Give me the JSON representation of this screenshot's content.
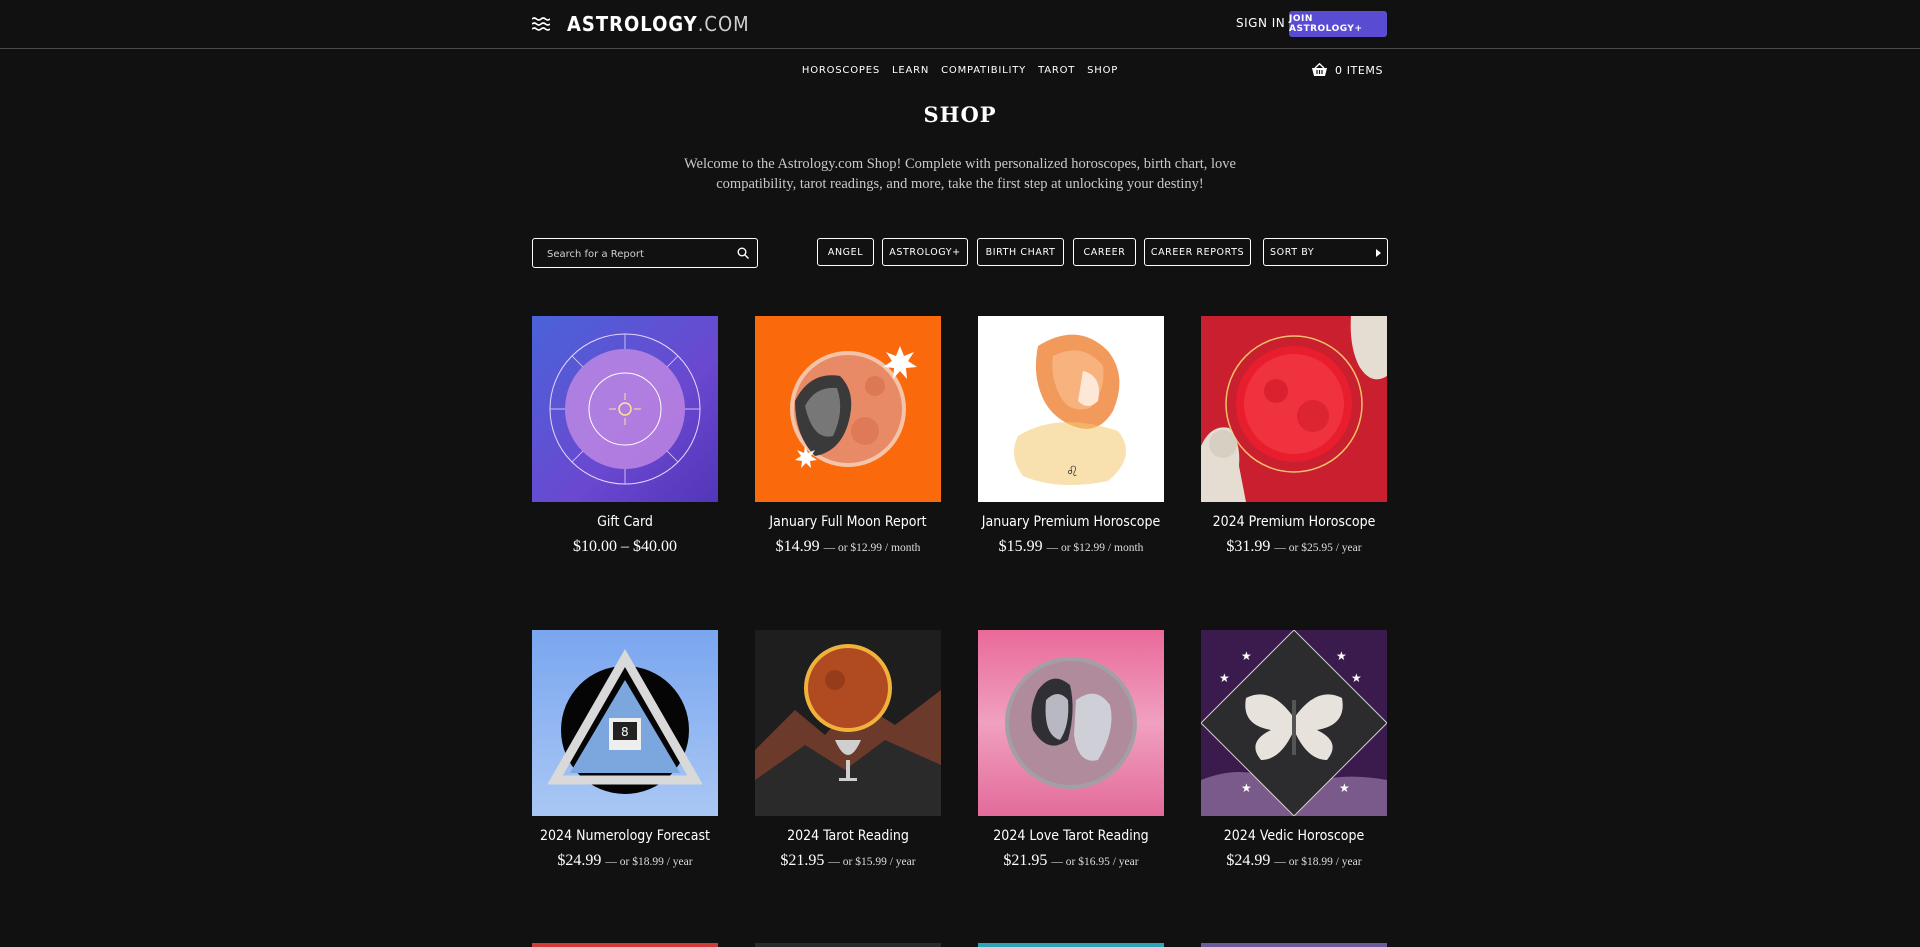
{
  "header": {
    "brand_main": "ASTROLOGY",
    "brand_suffix": ".COM",
    "signin": "SIGN IN",
    "join": "JOIN ASTROLOGY+"
  },
  "nav": [
    "HOROSCOPES",
    "LEARN",
    "COMPATIBILITY",
    "TAROT",
    "SHOP"
  ],
  "cart": {
    "label": "0 ITEMS"
  },
  "page": {
    "title": "SHOP",
    "intro": "Welcome to the Astrology.com Shop! Complete with personalized horoscopes, birth chart, love compatibility, tarot readings, and more, take the first step at unlocking your destiny!"
  },
  "search": {
    "placeholder": "Search for a Report"
  },
  "filters": [
    "ANGEL",
    "ASTROLOGY+",
    "BIRTH CHART",
    "CAREER",
    "CAREER REPORTS"
  ],
  "sort": {
    "label": "SORT BY"
  },
  "products": [
    {
      "name": "Gift Card",
      "price": "$10.00 – $40.00",
      "sub": ""
    },
    {
      "name": "January Full Moon Report",
      "price": "$14.99",
      "sub": "— or $12.99 / month"
    },
    {
      "name": "January Premium Horoscope",
      "price": "$15.99",
      "sub": "— or $12.99 / month"
    },
    {
      "name": "2024 Premium Horoscope",
      "price": "$31.99",
      "sub": "— or $25.95 / year"
    },
    {
      "name": "2024 Numerology Forecast",
      "price": "$24.99",
      "sub": "— or $18.99 / year"
    },
    {
      "name": "2024 Tarot Reading",
      "price": "$21.95",
      "sub": "— or $15.99 / year"
    },
    {
      "name": "2024 Love Tarot Reading",
      "price": "$21.95",
      "sub": "— or $16.95 / year"
    },
    {
      "name": "2024 Vedic Horoscope",
      "price": "$24.99",
      "sub": "— or $18.99 / year"
    }
  ],
  "colors": {
    "background": "#111112",
    "accent": "#5a4bd3"
  }
}
